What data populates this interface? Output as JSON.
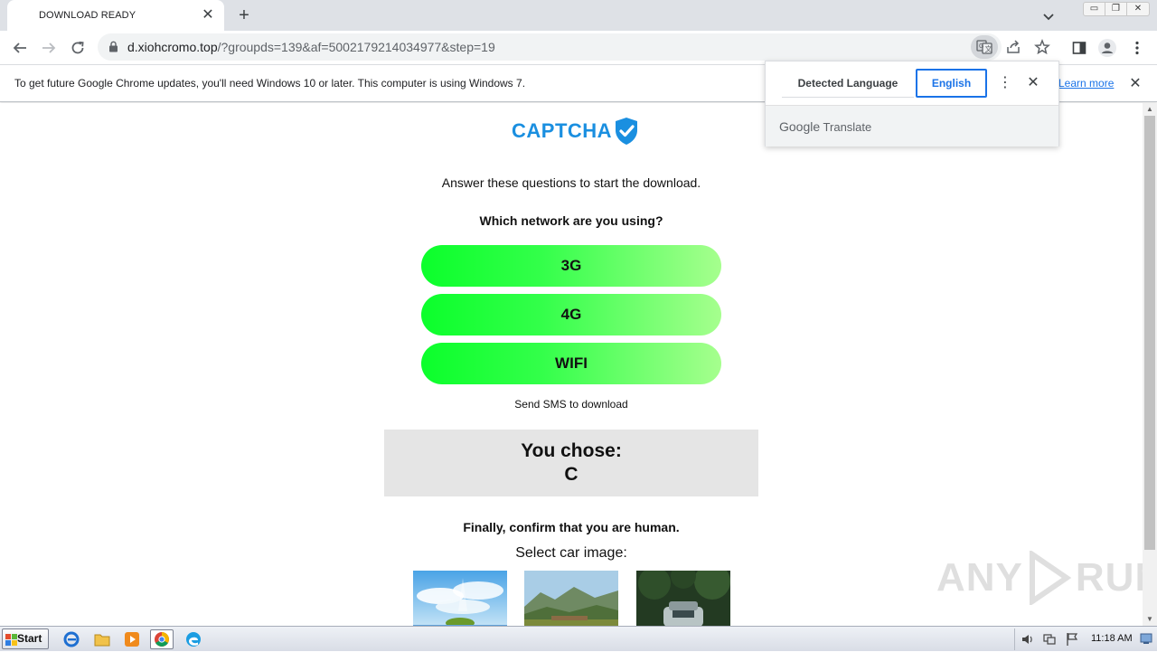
{
  "tab": {
    "title": "DOWNLOAD READY",
    "close": "✕",
    "new_tab": "+"
  },
  "window": {
    "minimize": "▭",
    "restore": "❐",
    "close": "✕"
  },
  "address": {
    "domain": "d.xiohcromo.top",
    "path": "/?groupds=139&af=5002179214034977&step=19"
  },
  "infobar": {
    "message": "To get future Google Chrome updates, you'll need Windows 10 or later. This computer is using Windows 7.",
    "learn_more": "Learn more",
    "close": "✕"
  },
  "translate": {
    "detected_tab": "Detected Language",
    "target_tab": "English",
    "more": "⋮",
    "close": "✕",
    "brand_google": "Google",
    "brand_translate": "Translate"
  },
  "page": {
    "logo": "CAPTCHA",
    "instruction": "Answer these questions to start the download.",
    "question": "Which network are you using?",
    "options": [
      "3G",
      "4G",
      "WIFI"
    ],
    "sms": "Send SMS to download",
    "you_chose_label": "You chose:",
    "you_chose_value": "C",
    "confirm": "Finally, confirm that you are human.",
    "select_car": "Select car image:"
  },
  "watermark": {
    "left": "ANY",
    "right": "RUN"
  },
  "taskbar": {
    "start": "Start",
    "clock": "11:18 AM"
  },
  "colors": {
    "option_start": "#0bff2b",
    "option_end": "#a6ff8e",
    "logo": "#1a8fe0",
    "link": "#1a73e8"
  }
}
